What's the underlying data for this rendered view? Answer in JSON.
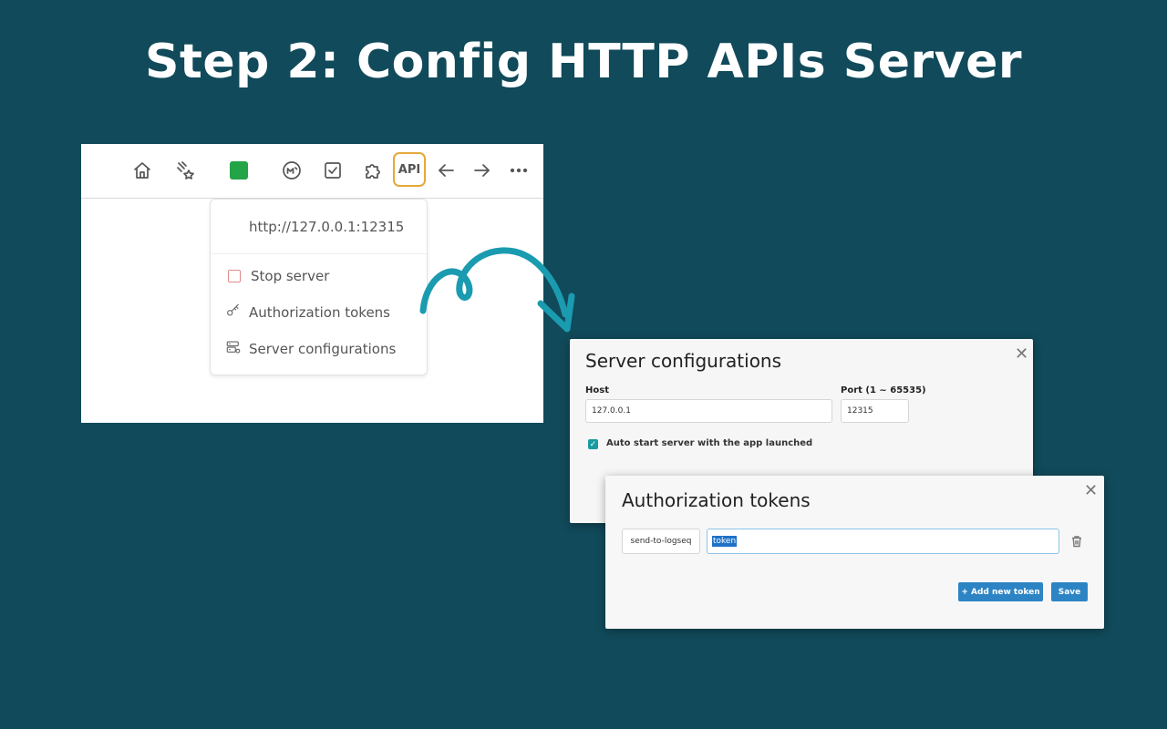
{
  "heading": "Step 2:  Config HTTP APIs Server",
  "colors": {
    "background": "#114a5a",
    "accent": "#e5a93a",
    "arrow": "#1a9bb0",
    "button": "#2d84c4"
  },
  "toolbar": {
    "icons": [
      "home-icon",
      "stars-icon",
      "green-square-icon",
      "logseq-m-icon",
      "checkbox-icon",
      "puzzle-icon"
    ],
    "api_label": "API",
    "nav": [
      "arrow-left-icon",
      "arrow-right-icon",
      "more-icon"
    ]
  },
  "dropdown": {
    "url": "http://127.0.0.1:12315",
    "items": [
      {
        "label": "Stop server",
        "icon": "stop-square-icon"
      },
      {
        "label": "Authorization tokens",
        "icon": "key-icon"
      },
      {
        "label": "Server configurations",
        "icon": "server-settings-icon"
      }
    ]
  },
  "server_dialog": {
    "title": "Server configurations",
    "close": "✕",
    "host_label": "Host",
    "host_value": "127.0.0.1",
    "port_label": "Port (1 ~ 65535)",
    "port_value": "12315",
    "autostart_label": "Auto start server with the app launched",
    "autostart_checked": true
  },
  "auth_dialog": {
    "title": "Authorization tokens",
    "close": "✕",
    "token_name": "send-to-logseq",
    "token_value": "token",
    "add_button": "+ Add new token",
    "save_button": "Save"
  }
}
